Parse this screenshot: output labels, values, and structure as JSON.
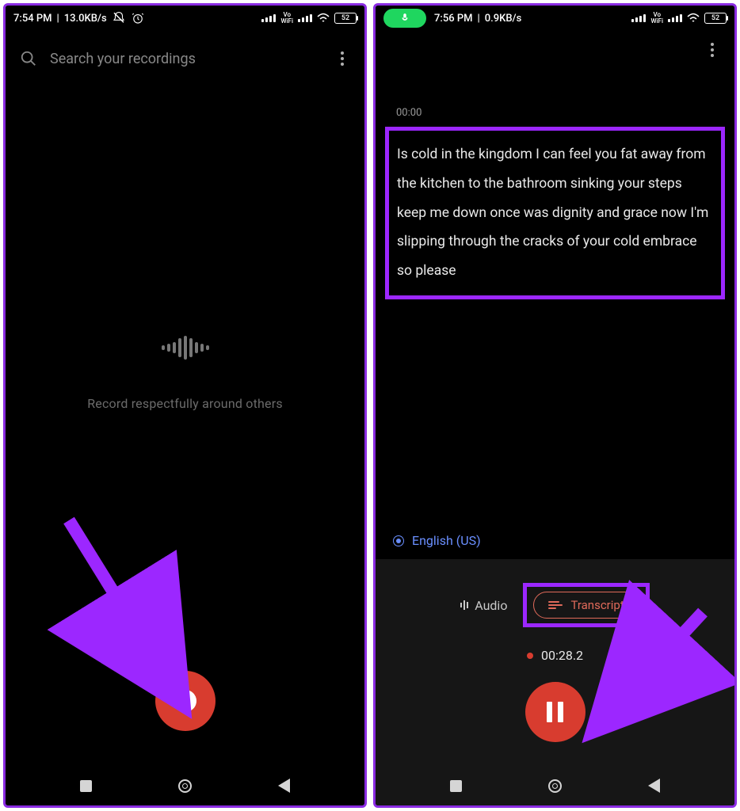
{
  "left": {
    "status": {
      "time": "7:54 PM",
      "net": "13.0KB/s",
      "battery": "52"
    },
    "search_placeholder": "Search your recordings",
    "hint": "Record respectfully around others"
  },
  "right": {
    "status": {
      "time": "7:56 PM",
      "net": "0.9KB/s",
      "battery": "52"
    },
    "timestamp": "00:00",
    "transcript_text": "Is cold in the kingdom I can feel you fat away from the kitchen to the bathroom sinking your steps keep me down once was dignity and grace now I'm slipping through the cracks of your cold embrace so please",
    "language_label": "English (US)",
    "audio_tab_label": "Audio",
    "transcript_tab_label": "Transcript",
    "rec_time": "00:28.2"
  }
}
